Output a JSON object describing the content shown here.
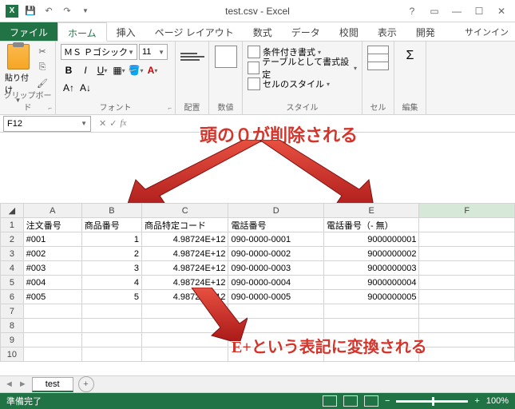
{
  "title": "test.csv - Excel",
  "qat": {
    "save": "save",
    "undo": "undo",
    "redo": "redo"
  },
  "tabs": {
    "file": "ファイル",
    "home": "ホーム",
    "insert": "挿入",
    "layout": "ページ レイアウト",
    "formula": "数式",
    "data": "データ",
    "review": "校閲",
    "view": "表示",
    "dev": "開発"
  },
  "signin": "サインイン",
  "ribbon": {
    "clipboard": {
      "label": "クリップボード",
      "paste": "貼り付け"
    },
    "font": {
      "label": "フォント",
      "name": "ＭＳ Ｐゴシック",
      "size": "11"
    },
    "align": {
      "label": "配置"
    },
    "number": {
      "label": "数値"
    },
    "styles": {
      "label": "スタイル",
      "cond": "条件付き書式",
      "table": "テーブルとして書式設定",
      "cell": "セルのスタイル"
    },
    "cells": {
      "label": "セル"
    },
    "edit": {
      "label": "編集"
    }
  },
  "namebox": "F12",
  "annotation1": "頭の０が削除される",
  "annotation2": "E+という表記に変換される",
  "headers": [
    "A",
    "B",
    "C",
    "D",
    "E",
    "F"
  ],
  "col_headers": {
    "a": "注文番号",
    "b": "商品番号",
    "c": "商品特定コード",
    "d": "電話番号",
    "e": "電話番号（- 無）"
  },
  "rows": [
    {
      "n": "1"
    },
    {
      "n": "2",
      "a": "#001",
      "b": "1",
      "c": "4.98724E+12",
      "d": "090-0000-0001",
      "e": "9000000001"
    },
    {
      "n": "3",
      "a": "#002",
      "b": "2",
      "c": "4.98724E+12",
      "d": "090-0000-0002",
      "e": "9000000002"
    },
    {
      "n": "4",
      "a": "#003",
      "b": "3",
      "c": "4.98724E+12",
      "d": "090-0000-0003",
      "e": "9000000003"
    },
    {
      "n": "5",
      "a": "#004",
      "b": "4",
      "c": "4.98724E+12",
      "d": "090-0000-0004",
      "e": "9000000004"
    },
    {
      "n": "6",
      "a": "#005",
      "b": "5",
      "c": "4.98724E+12",
      "d": "090-0000-0005",
      "e": "9000000005"
    },
    {
      "n": "7"
    },
    {
      "n": "8"
    },
    {
      "n": "9"
    },
    {
      "n": "10"
    }
  ],
  "sheet": "test",
  "status": "準備完了",
  "zoom": "100%"
}
